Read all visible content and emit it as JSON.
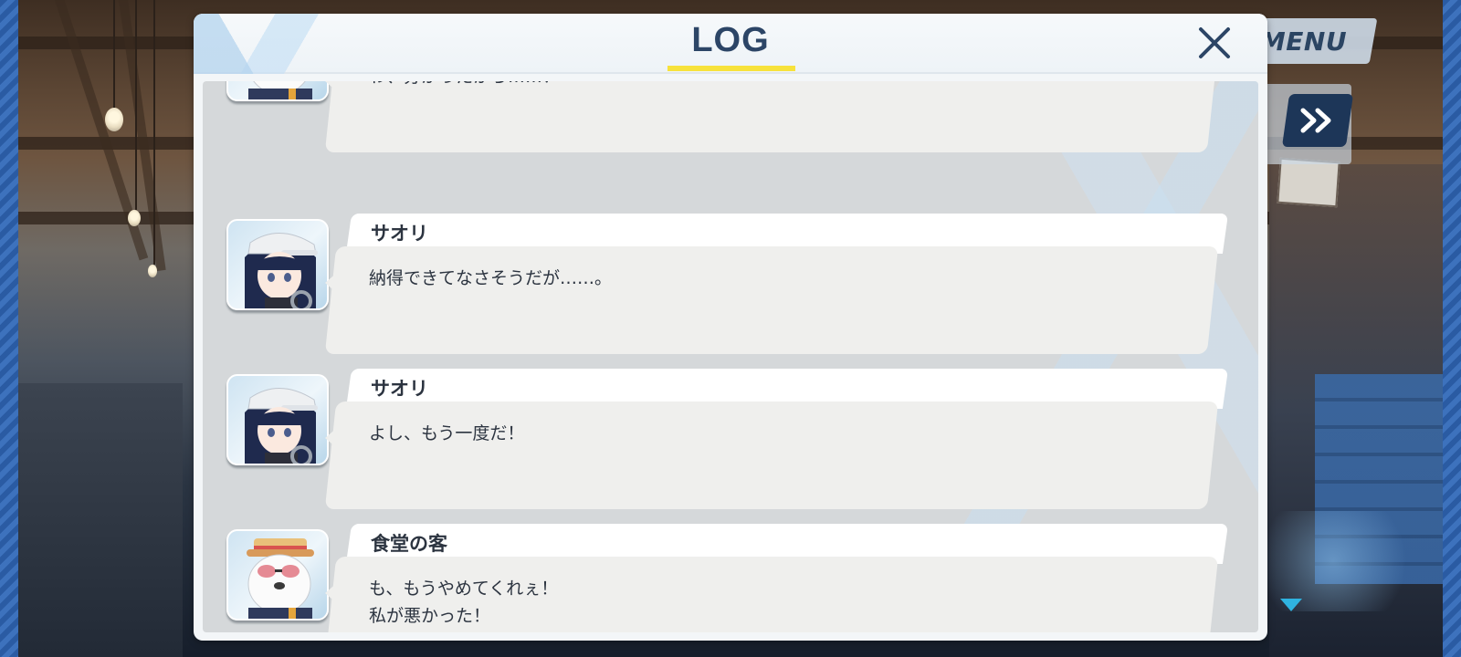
{
  "hud": {
    "menu_label": "MENU",
    "auto_icon": "auto-play-icon",
    "fast_forward_icon": "fast-forward-icon"
  },
  "log_dialog": {
    "title": "LOG",
    "close_icon": "close-icon",
    "entries": [
      {
        "speaker": "",
        "portrait": "bear-guest-portrait",
        "text": "わ、分かったから……！"
      },
      {
        "speaker": "サオリ",
        "portrait": "saori-portrait",
        "text": "納得できてなさそうだが……。"
      },
      {
        "speaker": "サオリ",
        "portrait": "saori-portrait",
        "text": "よし、もう一度だ！"
      },
      {
        "speaker": "食堂の客",
        "portrait": "bear-guest-portrait",
        "text": "も、もうやめてくれぇ！\n私が悪かった！"
      }
    ]
  },
  "colors": {
    "title_text": "#2c4566",
    "title_underline": "#f7e23c",
    "name_text": "#2c3440",
    "hud_button": "#1d3658"
  }
}
